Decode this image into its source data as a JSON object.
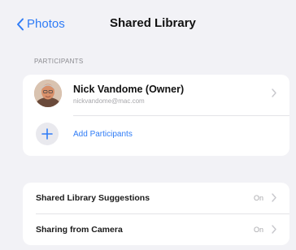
{
  "nav": {
    "back_label": "Photos",
    "title": "Shared Library"
  },
  "participants": {
    "section_header": "PARTICIPANTS",
    "owner": {
      "name": "Nick Vandome (Owner)",
      "email": "nickvandome@mac.com"
    },
    "add_label": "Add Participants"
  },
  "settings": [
    {
      "label": "Shared Library Suggestions",
      "value": "On"
    },
    {
      "label": "Sharing from Camera",
      "value": "On"
    }
  ],
  "colors": {
    "accent": "#2f7cf6",
    "background": "#f2f2f6",
    "card": "#ffffff",
    "secondary_text": "#a7a7ab"
  },
  "icons": {
    "back": "chevron-left-icon",
    "add": "plus-icon",
    "disclosure": "chevron-right-icon"
  }
}
